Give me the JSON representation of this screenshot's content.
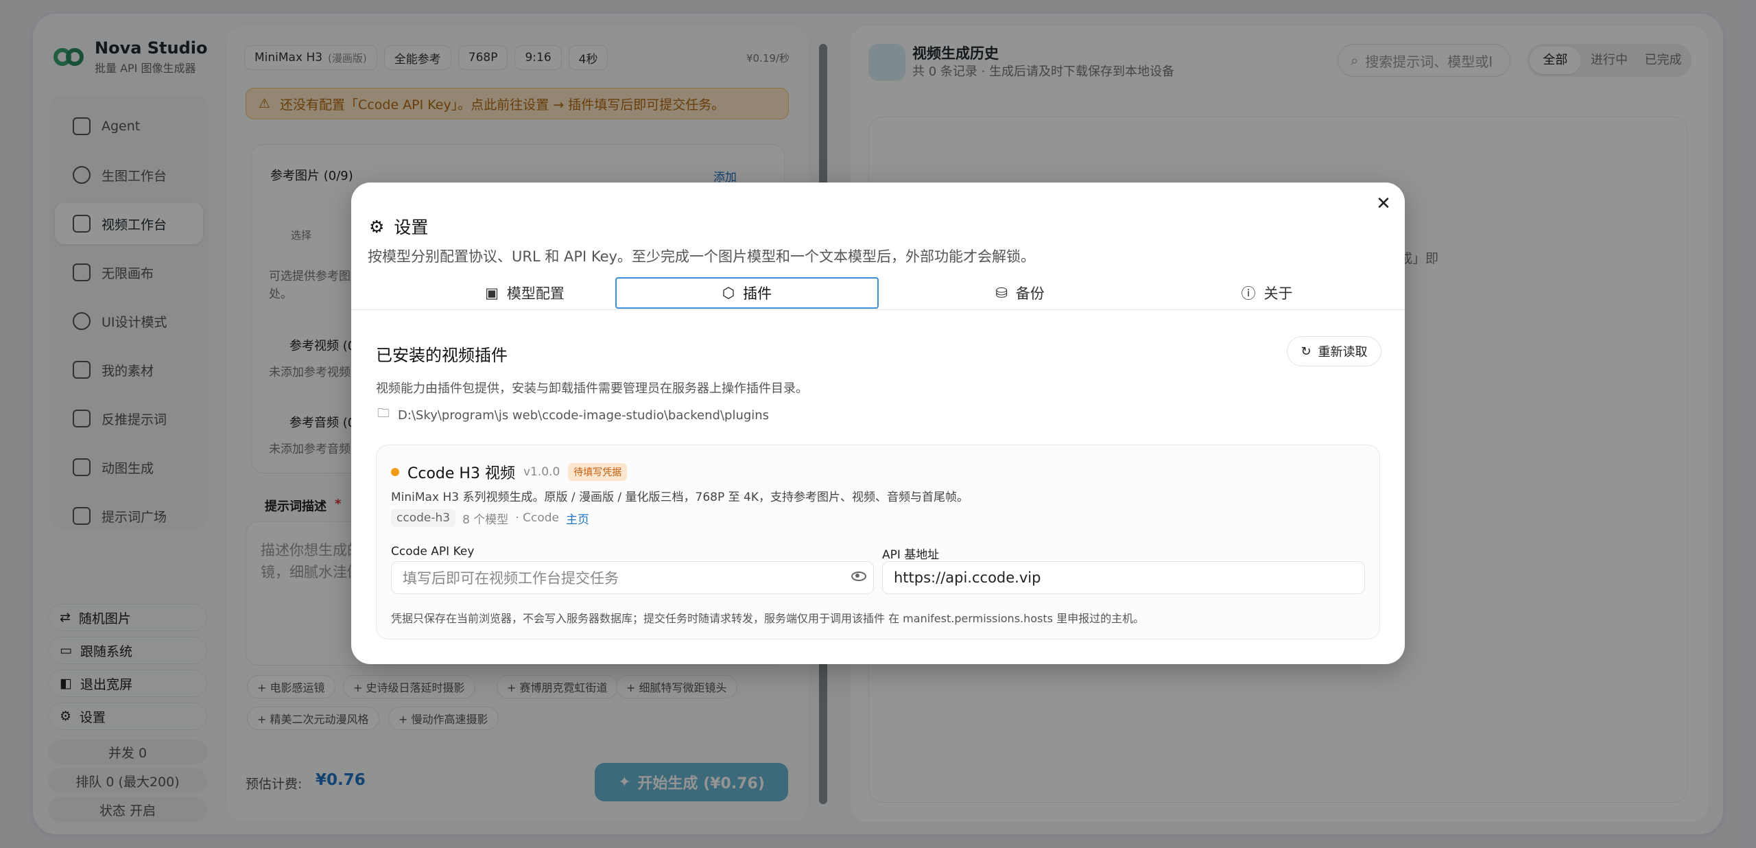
{
  "app": {
    "title": "Nova Studio",
    "subtitle": "批量 API 图像生成器"
  },
  "sidebar": {
    "items": [
      {
        "label": "Agent",
        "icon": "robot-icon"
      },
      {
        "label": "生图工作台",
        "icon": "sparkle-icon"
      },
      {
        "label": "视频工作台",
        "icon": "video-icon"
      },
      {
        "label": "无限画布",
        "icon": "grid-icon"
      },
      {
        "label": "UI设计模式",
        "icon": "scissors-icon"
      },
      {
        "label": "我的素材",
        "icon": "image-icon"
      },
      {
        "label": "反推提示词",
        "icon": "scan-icon"
      },
      {
        "label": "动图生成",
        "icon": "film-icon"
      },
      {
        "label": "提示词广场",
        "icon": "library-icon"
      }
    ],
    "active_index": 2,
    "bottom": {
      "random": "随机图片",
      "follow": "跟随系统",
      "exit_wide": "退出宽屏",
      "settings": "设置"
    },
    "stats": {
      "concurrency": "并发 0",
      "queue": "排队 0 (最大200)",
      "status": "状态 开启"
    }
  },
  "workbench": {
    "chips": {
      "model": "MiniMax H3",
      "model_variant": "(漫画版)",
      "ref": "全能参考",
      "res": "768P",
      "ratio": "9:16",
      "duration": "4秒"
    },
    "unit_price": "¥0.19/秒",
    "warning": "还没有配置「Ccode API Key」。点此前往设置 → 插件填写后即可提交任务。",
    "ref_images": {
      "title": "参考图片 (0/9)",
      "add": "添加",
      "select": "选择",
      "hint": "可选提供参考图片",
      "hint2": "处。"
    },
    "ref_video": {
      "title": "参考视频 (0",
      "empty": "未添加参考视频"
    },
    "ref_audio": {
      "title": "参考音频 (0",
      "empty": "未添加参考音频"
    },
    "prompt": {
      "title": "提示词描述",
      "required": "*",
      "placeholder_line1": "描述你想生成的",
      "placeholder_line2": "镜，细腻水洼倒"
    },
    "tags": [
      "+ 电影感运镜",
      "+ 史诗级日落延时摄影",
      "+ 赛博朋克霓虹街道",
      "+ 细腻特写微距镜头",
      "+ 精美二次元动漫风格",
      "+ 慢动作高速摄影"
    ],
    "estimate_label": "预估计费:",
    "estimate_value": "¥0.76",
    "generate": "开始生成 (¥0.76)"
  },
  "history": {
    "title": "视频生成历史",
    "subtitle": "共 0 条记录 · 生成后请及时下载保存到本地设备",
    "search_placeholder": "搜索提示词、模型或I",
    "filters": [
      "全部",
      "进行中",
      "已完成"
    ],
    "filter_active": 0,
    "partial_text": "成」即"
  },
  "settings_modal": {
    "title": "设置",
    "description": "按模型分别配置协议、URL 和 API Key。至少完成一个图片模型和一个文本模型后，外部功能才会解锁。",
    "tabs": [
      {
        "label": "模型配置",
        "icon": "image-icon"
      },
      {
        "label": "插件",
        "icon": "package-icon"
      },
      {
        "label": "备份",
        "icon": "database-icon"
      },
      {
        "label": "关于",
        "icon": "info-icon"
      }
    ],
    "active_tab": 1,
    "section_title": "已安装的视频插件",
    "reload": "重新读取",
    "section_desc": "视频能力由插件包提供，安装与卸载插件需要管理员在服务器上操作插件目录。",
    "plugin_path": "D:\\Sky\\program\\js web\\ccode-image-studio\\backend\\plugins",
    "plugin": {
      "name": "Ccode H3 视频",
      "version": "v1.0.0",
      "badge": "待填写凭据",
      "status_color": "#f29b17",
      "description": "MiniMax H3 系列视频生成。原版 / 漫画版 / 量化版三档，768P 至 4K，支持参考图片、视频、音频与首尾帧。",
      "id": "ccode-h3",
      "models": "8 个模型",
      "vendor": "· Ccode",
      "homepage": "主页",
      "api_key_label": "Ccode API Key",
      "api_key_placeholder": "填写后即可在视频工作台提交任务",
      "base_url_label": "API 基地址",
      "base_url_value": "https://api.ccode.vip",
      "note": "凭据只保存在当前浏览器，不会写入服务器数据库；提交任务时随请求转发，服务端仅用于调用该插件 在 manifest.permissions.hosts 里申报过的主机。"
    }
  }
}
